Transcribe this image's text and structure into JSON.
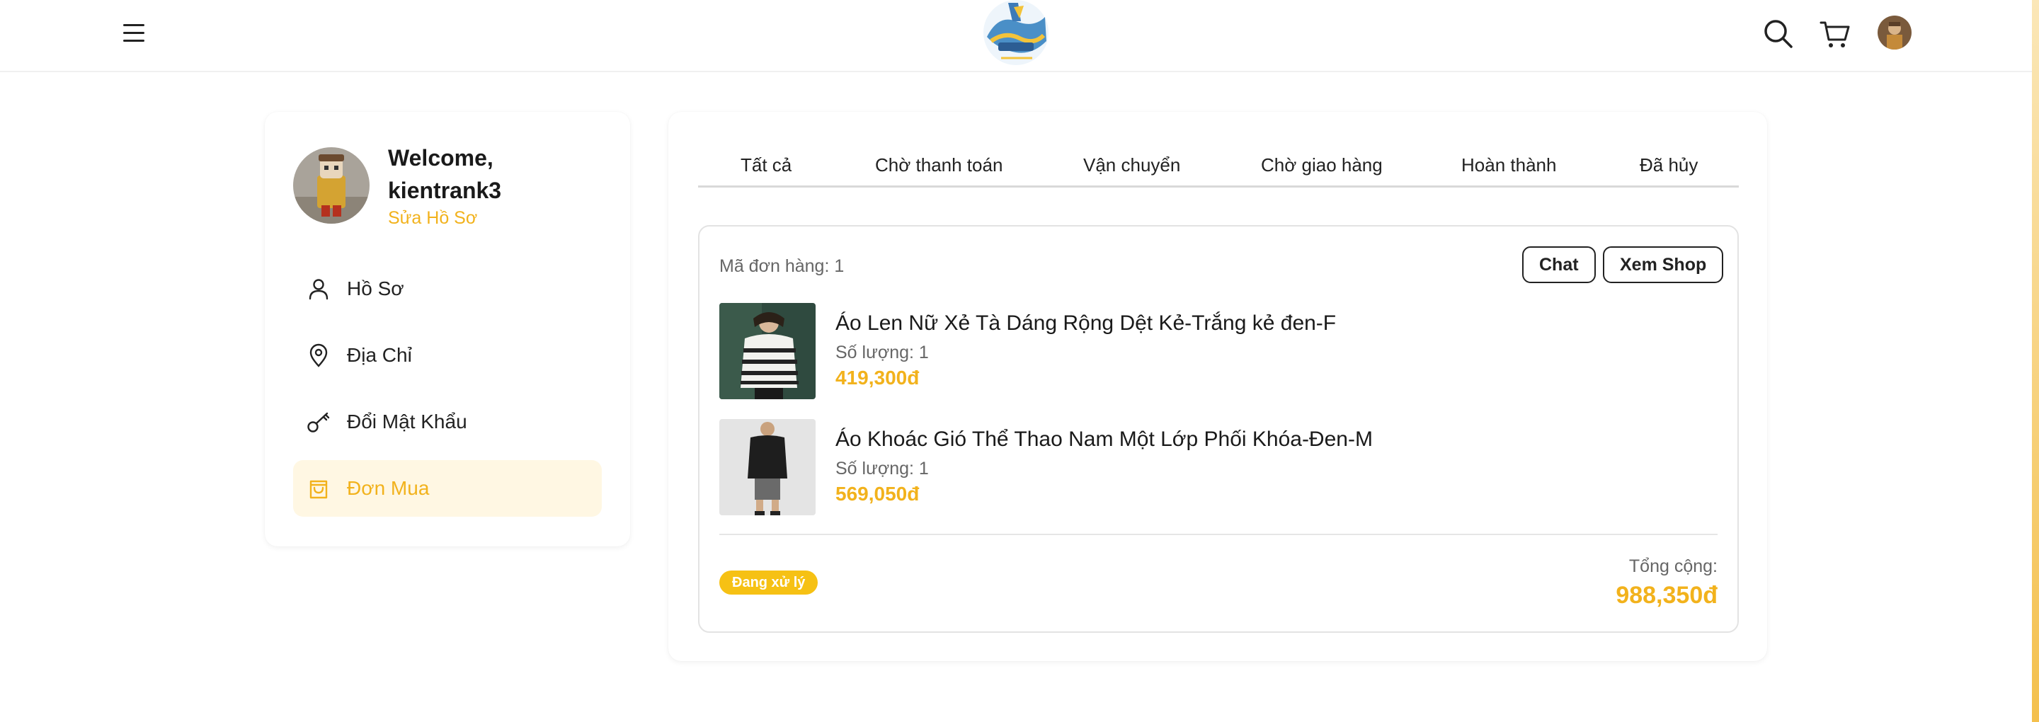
{
  "header": {
    "menu_icon": "hamburger-menu-icon",
    "logo_icon": "brand-logo",
    "search_icon": "search-icon",
    "cart_icon": "cart-icon",
    "avatar_icon": "user-avatar"
  },
  "sidebar": {
    "welcome": "Welcome,",
    "username": "kientrank3",
    "edit_profile": "Sửa Hồ Sơ",
    "items": [
      {
        "label": "Hồ Sơ",
        "icon": "user-icon"
      },
      {
        "label": "Địa Chỉ",
        "icon": "map-pin-icon"
      },
      {
        "label": "Đổi Mật Khẩu",
        "icon": "key-icon"
      },
      {
        "label": "Đơn Mua",
        "icon": "shopping-bag-icon",
        "active": true
      }
    ]
  },
  "tabs": [
    "Tất cả",
    "Chờ thanh toán",
    "Vận chuyển",
    "Chờ giao hàng",
    "Hoàn thành",
    "Đã hủy"
  ],
  "order": {
    "id_label": "Mã đơn hàng: 1",
    "chat_button": "Chat",
    "shop_button": "Xem Shop",
    "items": [
      {
        "name": "Áo Len Nữ Xẻ Tà Dáng Rộng Dệt Kẻ-Trắng kẻ đen-F",
        "qty": "Số lượng: 1",
        "price": "419,300đ"
      },
      {
        "name": "Áo Khoác Gió Thể Thao Nam Một Lớp Phối Khóa-Đen-M",
        "qty": "Số lượng: 1",
        "price": "569,050đ"
      }
    ],
    "status": "Đang xử lý",
    "total_label": "Tổng cộng:",
    "total_value": "988,350đ"
  },
  "colors": {
    "accent": "#f2b21c",
    "badge": "#f6c114",
    "active_bg": "#fff7e3"
  }
}
